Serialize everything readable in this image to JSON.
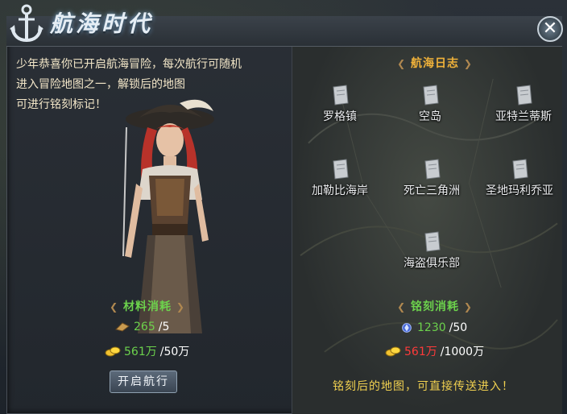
{
  "window": {
    "title": "航海时代",
    "close_label": "✕"
  },
  "intro": {
    "line1": "少年恭喜你已开启航海冒险，每次航行可随机",
    "line2": "进入冒险地图之一，解锁后的地图",
    "line3": "可进行铭刻标记！"
  },
  "materials": {
    "title": "材料消耗",
    "item1": {
      "have": "265",
      "need": "/5",
      "icon": "material-icon"
    },
    "item2": {
      "have": "561万",
      "need": "/50万",
      "icon": "gold-icon"
    }
  },
  "start_button": {
    "label": "开启航行"
  },
  "log": {
    "title": "航海日志",
    "nodes": [
      {
        "label": "罗格镇"
      },
      {
        "label": "空岛"
      },
      {
        "label": "亚特兰蒂斯"
      },
      {
        "label": "加勒比海岸"
      },
      {
        "label": "死亡三角洲"
      },
      {
        "label": "圣地玛利乔亚"
      },
      {
        "label": "海盗俱乐部"
      }
    ]
  },
  "engrave": {
    "title": "铭刻消耗",
    "item1": {
      "have": "1230",
      "need": "/50",
      "icon": "crystal-icon"
    },
    "item2": {
      "have": "561万",
      "need": "/1000万",
      "icon": "gold-icon"
    }
  },
  "footer": {
    "note": "铭刻后的地图，可直接传送进入！"
  },
  "colors": {
    "green": "#6cd24c",
    "red": "#ff3a3a",
    "gold": "#f0b23a",
    "note": "#f0d050"
  }
}
